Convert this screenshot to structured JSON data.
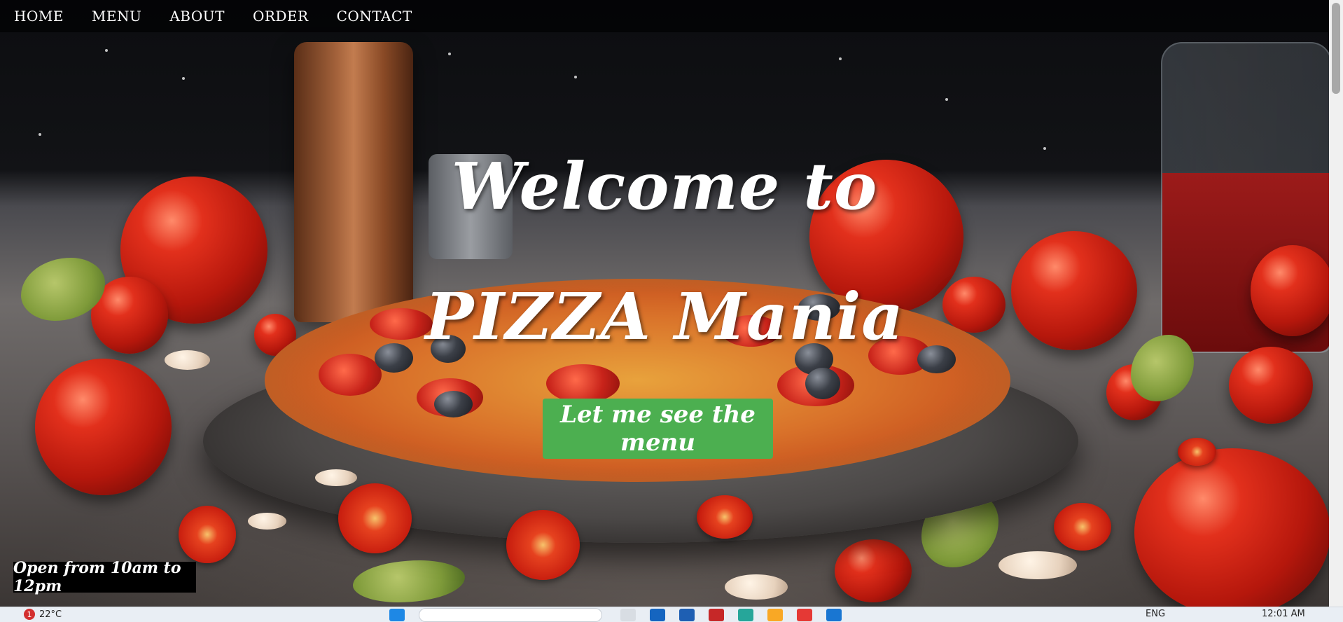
{
  "nav": {
    "items": [
      {
        "label": "HOME"
      },
      {
        "label": "MENU"
      },
      {
        "label": "ABOUT"
      },
      {
        "label": "ORDER"
      },
      {
        "label": "CONTACT"
      }
    ]
  },
  "hero": {
    "title_line1": "Welcome to",
    "title_line2": "PIZZA Mania",
    "cta_label": "Let me see the menu",
    "hours": "Open from 10am to 12pm"
  },
  "taskbar": {
    "weather_badge": "1",
    "temperature": "22°C",
    "language": "ENG",
    "time": "12:01 AM"
  },
  "colors": {
    "cta": "#4caf50",
    "navbar": "#000000",
    "hours_badge": "#000000"
  }
}
